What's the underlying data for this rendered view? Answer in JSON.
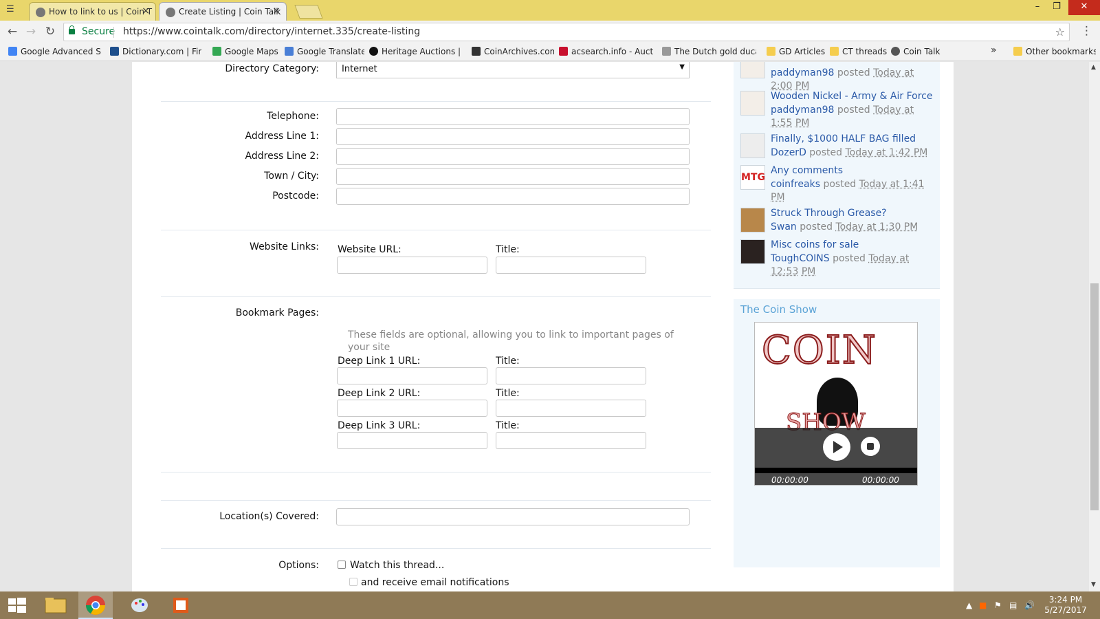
{
  "browser": {
    "tabs": [
      {
        "title": "How to link to us | Coin T",
        "active": false
      },
      {
        "title": "Create Listing | Coin Talk",
        "active": true
      }
    ],
    "close_glyph": "×",
    "secure_label": "Secure",
    "url": "https://www.cointalk.com/directory/internet.335/create-listing",
    "bookmarks": [
      {
        "label": "Google Advanced Sea",
        "icon": "google-icon"
      },
      {
        "label": "Dictionary.com | Find",
        "icon": "dictionary-icon"
      },
      {
        "label": "Google Maps",
        "icon": "maps-icon"
      },
      {
        "label": "Google Translate",
        "icon": "translate-icon"
      },
      {
        "label": "Heritage Auctions | W",
        "icon": "heritage-icon"
      },
      {
        "label": "CoinArchives.com",
        "icon": "coinarchives-icon"
      },
      {
        "label": "acsearch.info - Auctio",
        "icon": "acsearch-icon"
      },
      {
        "label": "The Dutch gold ducat",
        "icon": "ducat-icon"
      },
      {
        "label": "GD Articles",
        "icon": "folder-icon"
      },
      {
        "label": "CT threads",
        "icon": "folder-icon"
      },
      {
        "label": "Coin Talk",
        "icon": "cointalk-icon"
      }
    ],
    "overflow_label": "»",
    "other_bookmarks": "Other bookmarks"
  },
  "form": {
    "directory_category_label": "Directory Category:",
    "directory_category_value": "Internet",
    "telephone_label": "Telephone:",
    "address1_label": "Address Line 1:",
    "address2_label": "Address Line 2:",
    "town_label": "Town / City:",
    "postcode_label": "Postcode:",
    "website_links_label": "Website Links:",
    "website_url_label": "Website URL:",
    "title_label": "Title:",
    "bookmark_pages_label": "Bookmark Pages:",
    "bookmark_hint": "These fields are optional, allowing you to link to important pages of your site",
    "deep_links": [
      "Deep Link 1 URL:",
      "Deep Link 2 URL:",
      "Deep Link 3 URL:"
    ],
    "locations_label": "Location(s) Covered:",
    "options_label": "Options:",
    "watch_label": "Watch this thread...",
    "email_label": "and receive email notifications"
  },
  "sidebar": {
    "posts": [
      {
        "title": "",
        "user": "paddyman98",
        "verb": "posted",
        "time1": "Today at 2:00",
        "time2": "PM"
      },
      {
        "title": "Wooden Nickel - Army & Air Force",
        "user": "paddyman98",
        "verb": "posted",
        "time1": "Today at 1:55",
        "time2": "PM"
      },
      {
        "title": "Finally, $1000 HALF BAG filled",
        "user": "DozerD",
        "verb": "posted",
        "time1": "Today at 1:42 PM",
        "time2": ""
      },
      {
        "title": "Any comments",
        "user": "coinfreaks",
        "verb": "posted",
        "time1": "Today at 1:41",
        "time2": "PM"
      },
      {
        "title": "Struck Through Grease?",
        "user": "Swan",
        "verb": "posted",
        "time1": "Today at 1:30 PM",
        "time2": ""
      },
      {
        "title": "Misc coins for sale",
        "user": "ToughCOINS",
        "verb": "posted",
        "time1": "Today at 12:53",
        "time2": "PM"
      }
    ],
    "coin_show_title": "The Coin Show",
    "logo_top": "COIN",
    "logo_bottom": "SHOW",
    "time_elapsed": "00:00:00",
    "time_total": "00:00:00"
  },
  "taskbar": {
    "time": "3:24 PM",
    "date": "5/27/2017"
  }
}
